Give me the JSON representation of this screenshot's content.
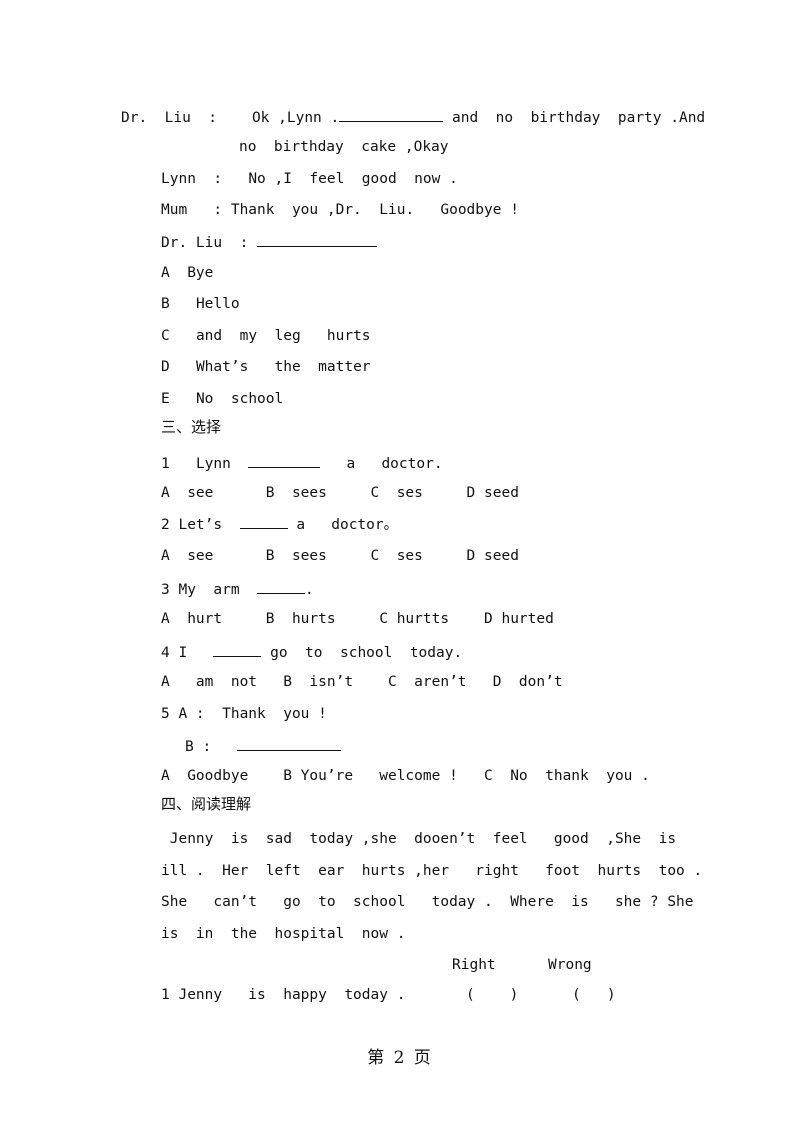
{
  "dialogue": {
    "line1": {
      "speaker": "Dr.  Liu  :",
      "before": "Ok ,Lynn .",
      "after": " and  no  birthday  party .And"
    },
    "line1_cont": "no  birthday  cake ,Okay",
    "line2": {
      "speaker": "Lynn  :",
      "text": "No ,I  feel  good  now ."
    },
    "line3": {
      "speaker": "Mum   :",
      "text": "Thank  you ,Dr.  Liu.   Goodbye !"
    },
    "line4": {
      "speaker": "Dr. Liu  :"
    }
  },
  "options": [
    {
      "letter": "A",
      "text": "Bye"
    },
    {
      "letter": "B",
      "text": "Hello"
    },
    {
      "letter": "C",
      "text": "and  my  leg   hurts"
    },
    {
      "letter": "D",
      "text": "What’s   the  matter"
    },
    {
      "letter": "E",
      "text": "No  school"
    }
  ],
  "section3": {
    "title": "三、选择",
    "questions": [
      {
        "num": "1",
        "before": "Lynn",
        "after": "a   doctor.",
        "choices": "A  see      B  sees     C  ses     D seed"
      },
      {
        "num": "2",
        "before": "Let’s",
        "after": "a   doctor。",
        "choices": "A  see      B  sees     C  ses     D seed"
      },
      {
        "num": "3",
        "before": "My  arm",
        "after": ".",
        "choices": "A  hurt     B  hurts     C hurtts    D hurted"
      },
      {
        "num": "4",
        "before": "I",
        "after": "go  to  school  today.",
        "choices": "A   am  not   B  isn’t    C  aren’t   D  don’t"
      }
    ],
    "q5": {
      "num": "5",
      "a_line": "A :  Thank  you !",
      "b_label": "B :",
      "choices": "A  Goodbye    B You’re   welcome !   C  No  thank  you ."
    }
  },
  "section4": {
    "title": "四、阅读理解",
    "passage": [
      " Jenny  is  sad  today ,she  dooen’t  feel   good  ,She  is",
      "ill .  Her  left  ear  hurts ,her   right   foot  hurts  too .",
      "She   can’t   go  to  school   today .  Where  is   she ? She",
      "is  in  the  hospital  now ."
    ],
    "header_right": "Right",
    "header_wrong": "Wrong",
    "statements": [
      {
        "text": "1 Jenny   is  happy  today .",
        "right_box": "(    )",
        "wrong_box": "(   )"
      }
    ]
  },
  "footer": {
    "page_label": "第 2 页"
  }
}
